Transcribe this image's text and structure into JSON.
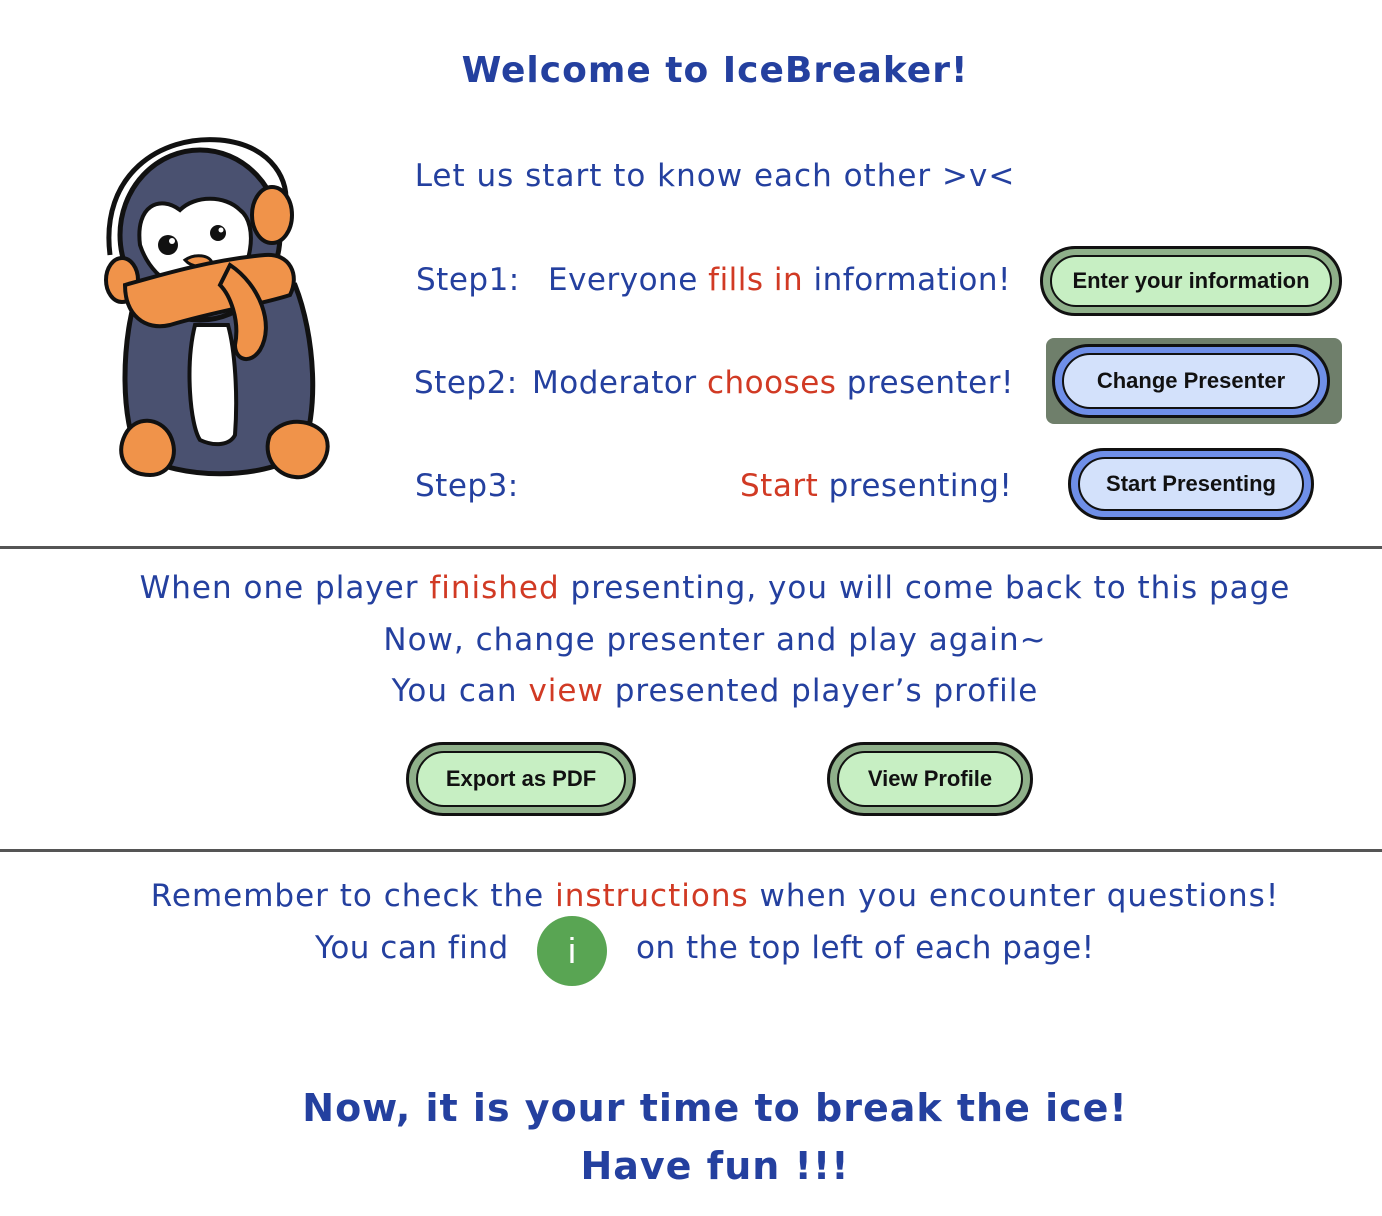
{
  "header": {
    "title": "Welcome to IceBreaker!",
    "subtitle": "Let us start to know each other >v<"
  },
  "steps": [
    {
      "label": "Step1:",
      "pre": "Everyone",
      "highlight": "fills in",
      "post": "information!",
      "button": "Enter your information"
    },
    {
      "label": "Step2:",
      "pre": "Moderator",
      "highlight": "chooses",
      "post": "presenter!",
      "button": "Change Presenter"
    },
    {
      "label": "Step3:",
      "pre": "",
      "highlight": "Start",
      "post": "presenting!",
      "button": "Start Presenting"
    }
  ],
  "middle": {
    "line1_pre": "When one player",
    "line1_highlight": "finished",
    "line1_post": "presenting, you will come back to this page",
    "line2": "Now, change presenter and play again~",
    "line3_pre": "You can",
    "line3_highlight": "view",
    "line3_post": "presented player’s profile",
    "export_button": "Export as PDF",
    "view_button": "View Profile"
  },
  "tips": {
    "line1_pre": "Remember to check the",
    "line1_highlight": "instructions",
    "line1_post": "when you encounter questions!",
    "line2_pre": "You can find",
    "info_icon_glyph": "i",
    "line2_post": "on the top left of each page!"
  },
  "footer": {
    "line1": "Now, it is your time to break the ice!",
    "line2": "Have fun !!!"
  },
  "colors": {
    "text_blue": "#24409f",
    "highlight_red": "#d13a24",
    "green_button": "#c7efc3",
    "blue_button": "#d3e1fb",
    "info_green": "#59a553"
  }
}
